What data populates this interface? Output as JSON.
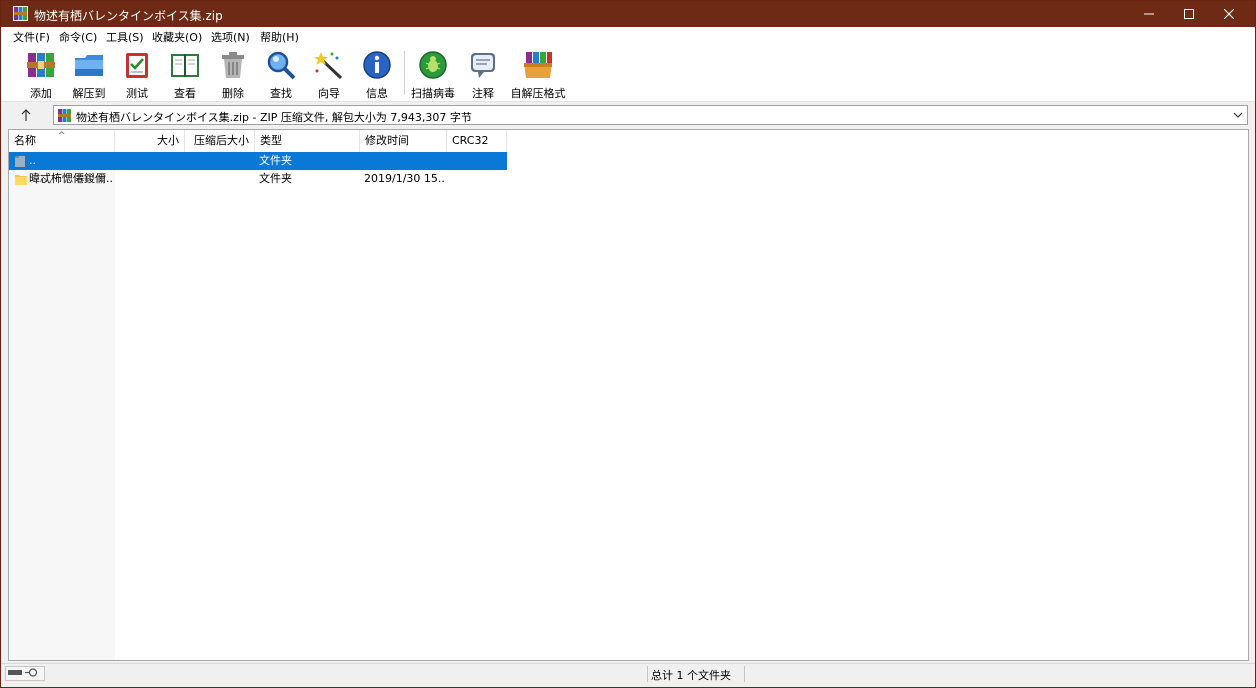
{
  "window": {
    "title": "物述有栖バレンタインボイス集.zip",
    "controls": [
      "minimize",
      "maximize",
      "close"
    ]
  },
  "menu": {
    "items": [
      {
        "label": "文件(F)"
      },
      {
        "label": "命令(C)"
      },
      {
        "label": "工具(S)"
      },
      {
        "label": "收藏夹(O)"
      },
      {
        "label": "选项(N)"
      },
      {
        "label": "帮助(H)"
      }
    ]
  },
  "toolbar": {
    "buttons": [
      {
        "label": "添加",
        "icon": "add-archive-icon"
      },
      {
        "label": "解压到",
        "icon": "extract-folder-icon"
      },
      {
        "label": "测试",
        "icon": "test-checklist-icon"
      },
      {
        "label": "查看",
        "icon": "view-book-icon"
      },
      {
        "label": "删除",
        "icon": "trash-icon"
      },
      {
        "label": "查找",
        "icon": "magnifier-icon"
      },
      {
        "label": "向导",
        "icon": "wizard-wand-icon"
      },
      {
        "label": "信息",
        "icon": "info-icon"
      },
      {
        "label": "扫描病毒",
        "icon": "virus-scan-icon"
      },
      {
        "label": "注释",
        "icon": "comment-icon"
      },
      {
        "label": "自解压格式",
        "icon": "sfx-box-icon"
      }
    ]
  },
  "address": {
    "text": "物述有栖バレンタインボイス集.zip - ZIP 压缩文件, 解包大小为 7,943,307 字节"
  },
  "columns": [
    "名称",
    "大小",
    "压缩后大小",
    "类型",
    "修改时间",
    "CRC32"
  ],
  "rows": [
    {
      "name": "..",
      "size": "",
      "packed": "",
      "type": "文件夹",
      "modified": "",
      "crc": "",
      "selected": true
    },
    {
      "name": "暐忒柨愢僊鍐儞...",
      "size": "",
      "packed": "",
      "type": "文件夹",
      "modified": "2019/1/30 15...",
      "crc": "",
      "selected": false
    }
  ],
  "status": {
    "summary": "总计 1 个文件夹"
  },
  "colors": {
    "titlebar": "#6e2a14",
    "selection": "#0a78d7"
  }
}
